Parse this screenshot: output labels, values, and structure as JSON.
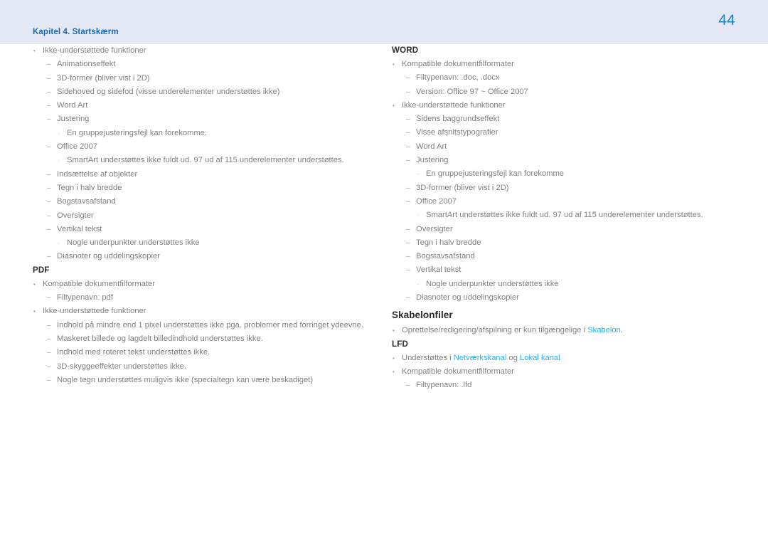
{
  "header": {
    "chapter_label": "Kapitel 4. Startskærm",
    "page_number": "44",
    "band_color": "#e4e8f5",
    "title_color": "#1b6bb2",
    "page_number_color": "#1b7fc4"
  },
  "theme": {
    "body_text_color": "#808080",
    "heading_color": "#2c2c2c",
    "link_color": "#29b2ec",
    "marker_color": "#9a9a9a"
  },
  "left_column": {
    "blocks": [
      {
        "type": "list",
        "items": [
          {
            "level": 1,
            "text": "Ikke-understøttede funktioner"
          },
          {
            "level": 2,
            "text": "Animationseffekt"
          },
          {
            "level": 2,
            "text": "3D-former (bliver vist i 2D)"
          },
          {
            "level": 2,
            "text": "Sidehoved og sidefod (visse underelementer understøttes ikke)"
          },
          {
            "level": 2,
            "text": "Word Art"
          },
          {
            "level": 2,
            "text": "Justering"
          },
          {
            "level": 3,
            "text": "En gruppejusteringsfejl kan forekomme."
          },
          {
            "level": 2,
            "text": "Office 2007"
          },
          {
            "level": 3,
            "text": "SmartArt understøttes ikke fuldt ud. 97 ud af 115 underelementer understøttes."
          },
          {
            "level": 2,
            "text": "Indsættelse af objekter"
          },
          {
            "level": 2,
            "text": "Tegn i halv bredde"
          },
          {
            "level": 2,
            "text": "Bogstavsafstand"
          },
          {
            "level": 2,
            "text": "Oversigter"
          },
          {
            "level": 2,
            "text": "Vertikal tekst"
          },
          {
            "level": 3,
            "text": "Nogle underpunkter understøttes ikke"
          },
          {
            "level": 2,
            "text": "Diasnoter og uddelingskopier"
          }
        ]
      },
      {
        "type": "heading",
        "style": "caps",
        "text": "PDF"
      },
      {
        "type": "list",
        "items": [
          {
            "level": 1,
            "text": "Kompatible dokumentfilformater"
          },
          {
            "level": 2,
            "text": "Filtypenavn: pdf"
          },
          {
            "level": 1,
            "text": "Ikke-understøttede funktioner"
          },
          {
            "level": 2,
            "text": "Indhold på mindre end 1 pixel understøttes ikke pga. problemer med forringet ydeevne."
          },
          {
            "level": 2,
            "text": "Maskeret billede og lagdelt billedindhold understøttes ikke."
          },
          {
            "level": 2,
            "text": "Indhold med roteret tekst understøttes ikke."
          },
          {
            "level": 2,
            "text": "3D-skyggeeffekter understøttes ikke."
          },
          {
            "level": 2,
            "text": "Nogle tegn understøttes muligvis ikke (specialtegn kan være beskadiget)"
          }
        ]
      }
    ]
  },
  "right_column": {
    "blocks": [
      {
        "type": "heading",
        "style": "caps",
        "text": "WORD"
      },
      {
        "type": "list",
        "items": [
          {
            "level": 1,
            "text": "Kompatible dokumentfilformater"
          },
          {
            "level": 2,
            "text": "Filtypenavn: .doc, .docx"
          },
          {
            "level": 2,
            "text": "Version: Office 97 ~ Office 2007"
          },
          {
            "level": 1,
            "text": "Ikke-understøttede funktioner"
          },
          {
            "level": 2,
            "text": "Sidens baggrundseffekt"
          },
          {
            "level": 2,
            "text": "Visse afsnitstypografier"
          },
          {
            "level": 2,
            "text": "Word Art"
          },
          {
            "level": 2,
            "text": "Justering"
          },
          {
            "level": 3,
            "text": "En gruppejusteringsfejl kan forekomme"
          },
          {
            "level": 2,
            "text": "3D-former (bliver vist i 2D)"
          },
          {
            "level": 2,
            "text": "Office 2007"
          },
          {
            "level": 3,
            "text": "SmartArt understøttes ikke fuldt ud. 97 ud af 115 underelementer understøttes."
          },
          {
            "level": 2,
            "text": "Oversigter"
          },
          {
            "level": 2,
            "text": "Tegn i halv bredde"
          },
          {
            "level": 2,
            "text": "Bogstavsafstand"
          },
          {
            "level": 2,
            "text": "Vertikal tekst"
          },
          {
            "level": 3,
            "text": "Nogle underpunkter understøttes ikke"
          },
          {
            "level": 2,
            "text": "Diasnoter og uddelingskopier"
          }
        ]
      },
      {
        "type": "heading",
        "style": "title",
        "text": "Skabelonfiler"
      },
      {
        "type": "list",
        "items": [
          {
            "level": 1,
            "runs": [
              {
                "text": "Oprettelse/redigering/afspilning er kun tilgængelige i ",
                "link": false
              },
              {
                "text": "Skabelon",
                "link": true
              },
              {
                "text": ".",
                "link": false
              }
            ]
          }
        ]
      },
      {
        "type": "heading",
        "style": "caps",
        "text": "LFD"
      },
      {
        "type": "list",
        "items": [
          {
            "level": 1,
            "runs": [
              {
                "text": "Understøttes i ",
                "link": false
              },
              {
                "text": "Netværkskanal",
                "link": true
              },
              {
                "text": " og ",
                "link": false
              },
              {
                "text": "Lokal kanal",
                "link": true
              }
            ]
          },
          {
            "level": 1,
            "text": "Kompatible dokumentfilformater"
          },
          {
            "level": 2,
            "text": "Filtypenavn: .lfd"
          }
        ]
      }
    ]
  },
  "markers": {
    "level1": "•",
    "level2": "–",
    "level3": "·"
  }
}
